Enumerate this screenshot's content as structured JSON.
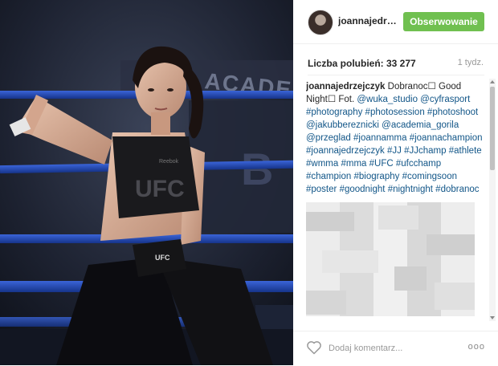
{
  "header": {
    "username": "joannajedrzejczyk",
    "follow_label": "Obserwowanie",
    "follow_color": "#70c050"
  },
  "post": {
    "likes": "Liczba polubień: 33 277",
    "time": "1 tydz.",
    "caption": {
      "author": "joannajedrzejczyk",
      "text": " Dobranoc☐ Good Night☐ Fot. ",
      "tags": [
        "@wuka_studio",
        "@cyfrasport",
        "#photography",
        "#photosession",
        "#photoshoot",
        "@jakubbereznicki",
        "@academia_gorila",
        "@przeglad",
        "#joannamma",
        "#joannachampion",
        "#joannajedrzejczyk",
        "#JJ",
        "#JJchamp",
        "#athlete",
        "#wmma",
        "#mma",
        "#UFC",
        "#ufcchamp",
        "#champion",
        "#biography",
        "#comingsoon",
        "#poster",
        "#goodnight",
        "#nightnight",
        "#dobranoc"
      ]
    }
  },
  "photo": {
    "banner_text": "ACADEMIA",
    "shirt_text": "UFC",
    "glove_text": "UFC",
    "logo_text": "Reebok"
  },
  "footer": {
    "comment_placeholder": "Dodaj komentarz...",
    "more_label": "ooo",
    "heart_icon": "heart-outline-icon"
  },
  "colors": {
    "tag": "#125688",
    "text": "#262626",
    "muted": "#999999"
  }
}
